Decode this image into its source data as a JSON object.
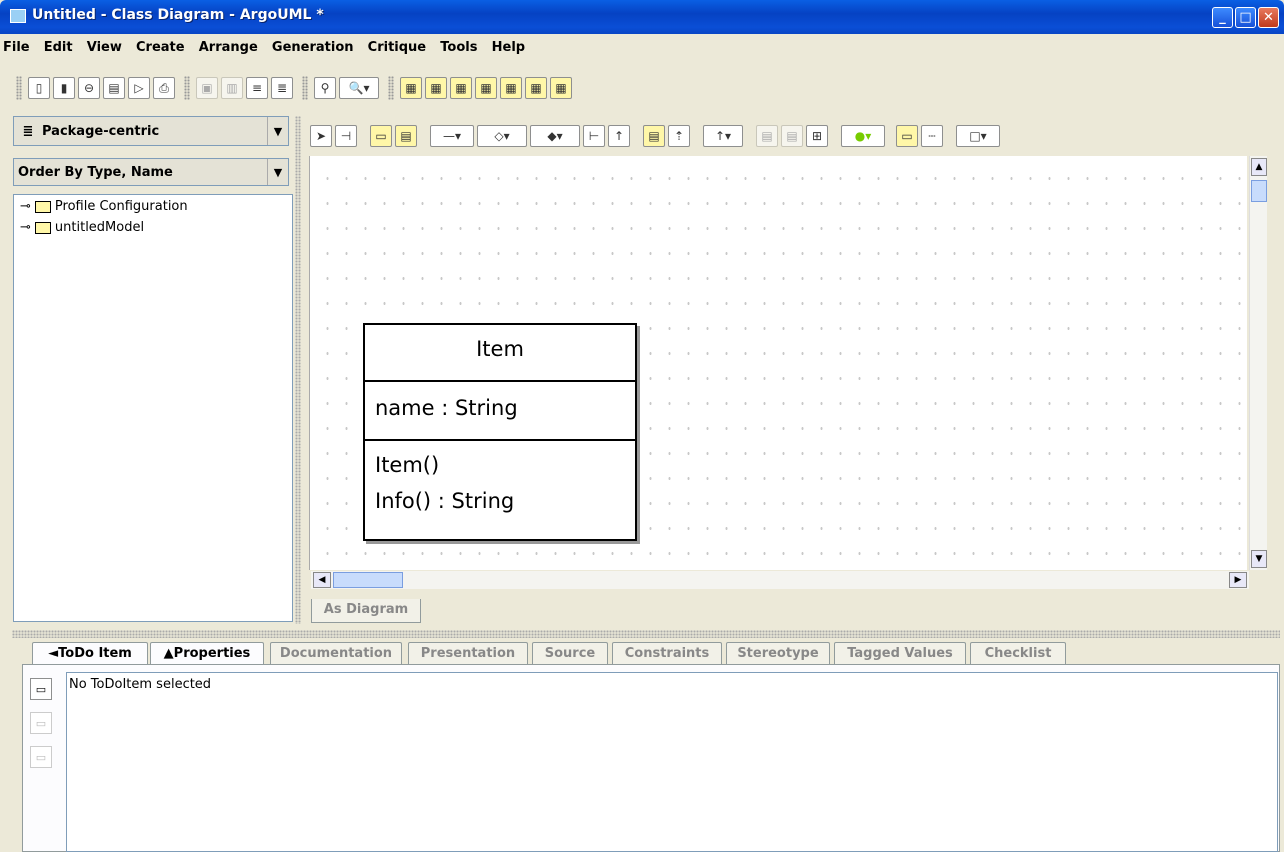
{
  "window": {
    "title": "Untitled - Class Diagram - ArgoUML *"
  },
  "menu": [
    "File",
    "Edit",
    "View",
    "Create",
    "Arrange",
    "Generation",
    "Critique",
    "Tools",
    "Help"
  ],
  "left_panel": {
    "perspective": "Package-centric",
    "order": "Order By Type, Name",
    "tree": [
      "Profile Configuration",
      "untitledModel"
    ]
  },
  "diagram": {
    "class_name": "Item",
    "attribute": "name : String",
    "operations": [
      "Item()",
      "Info() : String"
    ],
    "tab_label": "As Diagram"
  },
  "details": {
    "tabs": [
      "◄ToDo Item",
      "▲Properties",
      "Documentation",
      "Presentation",
      "Source",
      "Constraints",
      "Stereotype",
      "Tagged Values",
      "Checklist"
    ],
    "message": "No ToDoItem selected"
  },
  "colors": {
    "title_bar": "#0a4ed6",
    "chrome": "#ece9d8",
    "note": "#fff7a8"
  }
}
